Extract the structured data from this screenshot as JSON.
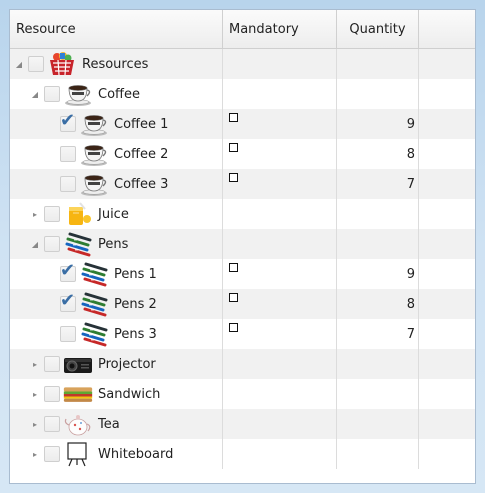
{
  "columns": {
    "resource": "Resource",
    "mandatory": "Mandatory",
    "quantity": "Quantity"
  },
  "rows": [
    {
      "label": "Resources",
      "level": 0,
      "expanded": true,
      "hasChildren": true,
      "checked": false,
      "icon": "basket-icon",
      "mandatory": false,
      "quantity": ""
    },
    {
      "label": "Coffee",
      "level": 1,
      "expanded": true,
      "hasChildren": true,
      "checked": false,
      "icon": "coffee-cup-icon",
      "mandatory": false,
      "quantity": ""
    },
    {
      "label": "Coffee 1",
      "level": 2,
      "expanded": false,
      "hasChildren": false,
      "checked": true,
      "icon": "coffee-cup-icon",
      "mandatory": true,
      "quantity": "9"
    },
    {
      "label": "Coffee 2",
      "level": 2,
      "expanded": false,
      "hasChildren": false,
      "checked": false,
      "icon": "coffee-cup-icon",
      "mandatory": true,
      "quantity": "8"
    },
    {
      "label": "Coffee 3",
      "level": 2,
      "expanded": false,
      "hasChildren": false,
      "checked": false,
      "icon": "coffee-cup-icon",
      "mandatory": true,
      "quantity": "7"
    },
    {
      "label": "Juice",
      "level": 1,
      "expanded": false,
      "hasChildren": true,
      "checked": false,
      "icon": "juice-icon",
      "mandatory": false,
      "quantity": ""
    },
    {
      "label": "Pens",
      "level": 1,
      "expanded": true,
      "hasChildren": true,
      "checked": false,
      "icon": "pens-icon",
      "mandatory": false,
      "quantity": ""
    },
    {
      "label": "Pens 1",
      "level": 2,
      "expanded": false,
      "hasChildren": false,
      "checked": true,
      "icon": "pens-icon",
      "mandatory": true,
      "quantity": "9"
    },
    {
      "label": "Pens 2",
      "level": 2,
      "expanded": false,
      "hasChildren": false,
      "checked": true,
      "icon": "pens-icon",
      "mandatory": true,
      "quantity": "8"
    },
    {
      "label": "Pens 3",
      "level": 2,
      "expanded": false,
      "hasChildren": false,
      "checked": false,
      "icon": "pens-icon",
      "mandatory": true,
      "quantity": "7"
    },
    {
      "label": "Projector",
      "level": 1,
      "expanded": false,
      "hasChildren": true,
      "checked": false,
      "icon": "projector-icon",
      "mandatory": false,
      "quantity": ""
    },
    {
      "label": "Sandwich",
      "level": 1,
      "expanded": false,
      "hasChildren": true,
      "checked": false,
      "icon": "sandwich-icon",
      "mandatory": false,
      "quantity": ""
    },
    {
      "label": "Tea",
      "level": 1,
      "expanded": false,
      "hasChildren": true,
      "checked": false,
      "icon": "teapot-icon",
      "mandatory": false,
      "quantity": ""
    },
    {
      "label": "Whiteboard",
      "level": 1,
      "expanded": false,
      "hasChildren": true,
      "checked": false,
      "icon": "whiteboard-icon",
      "mandatory": false,
      "quantity": ""
    }
  ],
  "colors": {
    "check": "#3a6ea5",
    "altRow": "#f1f1f1",
    "border": "#a9bcd0"
  }
}
